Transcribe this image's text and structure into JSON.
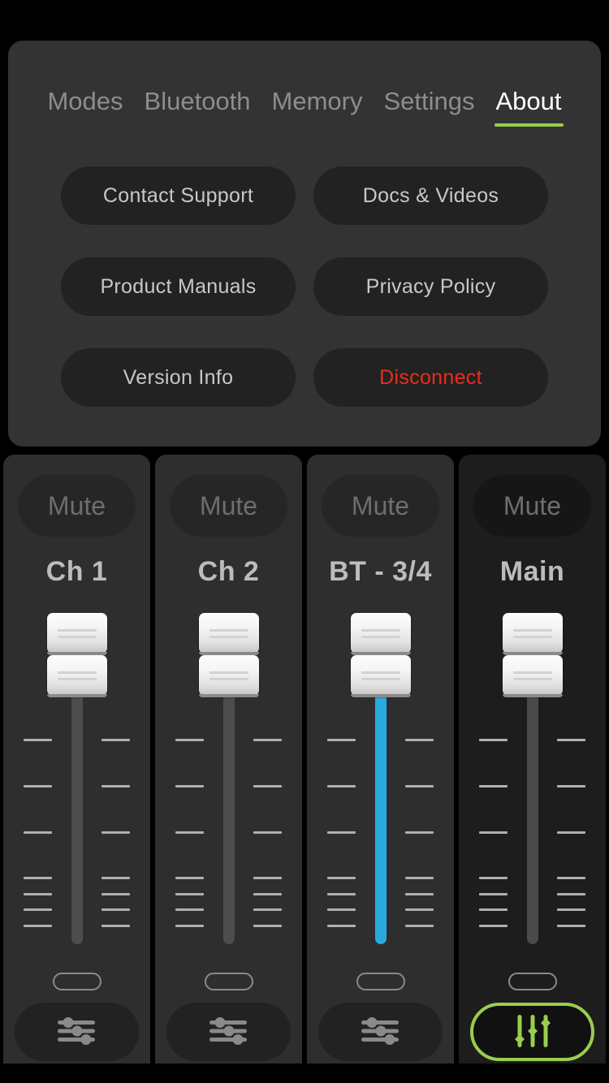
{
  "header": {
    "tabs": [
      {
        "label": "Modes",
        "active": false
      },
      {
        "label": "Bluetooth",
        "active": false
      },
      {
        "label": "Memory",
        "active": false
      },
      {
        "label": "Settings",
        "active": false
      },
      {
        "label": "About",
        "active": true
      }
    ],
    "active_tab_accent": "#9acd4e"
  },
  "about": {
    "buttons": [
      {
        "label": "Contact Support",
        "style": "normal"
      },
      {
        "label": "Docs & Videos",
        "style": "normal"
      },
      {
        "label": "Product Manuals",
        "style": "normal"
      },
      {
        "label": "Privacy Policy",
        "style": "normal"
      },
      {
        "label": "Version Info",
        "style": "normal"
      },
      {
        "label": "Disconnect",
        "style": "danger"
      }
    ],
    "danger_color": "#ee2b1b"
  },
  "mixer": {
    "mute_label": "Mute",
    "channels": [
      {
        "name": "Ch 1",
        "mute_label": "Mute",
        "muted": false,
        "fader_color": "#4d4d4d",
        "fader_position_pct": 88,
        "eq_icon": "horizontal-sliders-icon",
        "eq_active": false,
        "selected": false
      },
      {
        "name": "Ch 2",
        "mute_label": "Mute",
        "muted": false,
        "fader_color": "#4d4d4d",
        "fader_position_pct": 88,
        "eq_icon": "horizontal-sliders-icon",
        "eq_active": false,
        "selected": false
      },
      {
        "name": "BT - 3/4",
        "mute_label": "Mute",
        "muted": false,
        "fader_color": "#29abe2",
        "fader_position_pct": 88,
        "eq_icon": "horizontal-sliders-icon",
        "eq_active": false,
        "selected": false
      },
      {
        "name": "Main",
        "mute_label": "Mute",
        "muted": false,
        "fader_color": "#4a4a4a",
        "fader_position_pct": 88,
        "eq_icon": "vertical-sliders-icon",
        "eq_active": true,
        "selected": true
      }
    ],
    "accent_color": "#9acd4e",
    "bt_fader_color": "#29abe2"
  }
}
